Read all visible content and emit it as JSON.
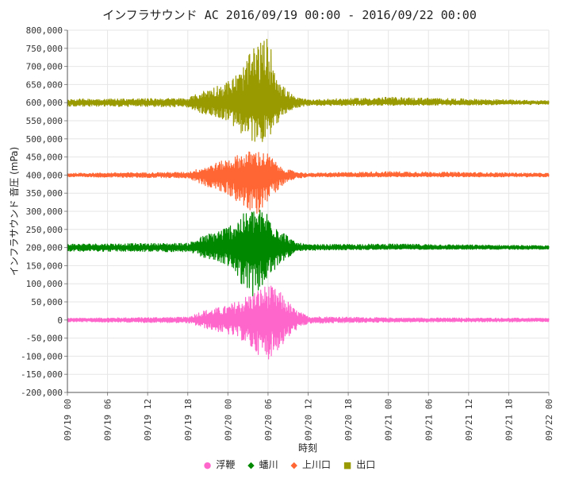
{
  "chart_data": {
    "type": "line",
    "title": "インフラサウンド AC 2016/09/19 00:00 - 2016/09/22 00:00",
    "xlabel": "時刻",
    "ylabel": "インフラサウンド 音圧 (mPa)",
    "ylim": [
      -200000,
      800000
    ],
    "yticks": [
      "800,000",
      "750,000",
      "700,000",
      "650,000",
      "600,000",
      "550,000",
      "500,000",
      "450,000",
      "400,000",
      "350,000",
      "300,000",
      "250,000",
      "200,000",
      "150,000",
      "100,000",
      "50,000",
      "0",
      "-50,000",
      "-100,000",
      "-150,000",
      "-200,000"
    ],
    "xlim_hours": [
      0,
      72
    ],
    "xticks": [
      "09/19 00",
      "09/19 06",
      "09/19 12",
      "09/19 18",
      "09/20 00",
      "09/20 06",
      "09/20 12",
      "09/20 18",
      "09/21 00",
      "09/21 06",
      "09/21 12",
      "09/21 18",
      "09/22 00"
    ],
    "grid": true,
    "legend_position": "bottom",
    "series": [
      {
        "name": "浮鞭",
        "color": "#ff66cc",
        "marker": "dot",
        "baseline": 0,
        "envelope": [
          [
            0,
            -5000,
            5000
          ],
          [
            18,
            -8000,
            8000
          ],
          [
            20,
            -20000,
            25000
          ],
          [
            24,
            -40000,
            40000
          ],
          [
            26,
            -55000,
            60000
          ],
          [
            28,
            -90000,
            80000
          ],
          [
            30,
            -110000,
            100000
          ],
          [
            32,
            -75000,
            75000
          ],
          [
            34,
            -30000,
            30000
          ],
          [
            36,
            -10000,
            10000
          ],
          [
            48,
            -6000,
            6000
          ],
          [
            72,
            -5000,
            5000
          ]
        ]
      },
      {
        "name": "蟠川",
        "color": "#008800",
        "marker": "diamond",
        "baseline": 200000,
        "envelope": [
          [
            0,
            190000,
            210000
          ],
          [
            18,
            188000,
            212000
          ],
          [
            20,
            175000,
            230000
          ],
          [
            24,
            150000,
            260000
          ],
          [
            26,
            100000,
            290000
          ],
          [
            28,
            60000,
            310000
          ],
          [
            30,
            110000,
            300000
          ],
          [
            32,
            160000,
            250000
          ],
          [
            34,
            185000,
            215000
          ],
          [
            36,
            192000,
            208000
          ],
          [
            48,
            195000,
            210000
          ],
          [
            72,
            195000,
            205000
          ]
        ]
      },
      {
        "name": "上川口",
        "color": "#ff6633",
        "marker": "diamond",
        "baseline": 400000,
        "envelope": [
          [
            0,
            395000,
            405000
          ],
          [
            18,
            392000,
            408000
          ],
          [
            20,
            375000,
            420000
          ],
          [
            24,
            345000,
            445000
          ],
          [
            26,
            320000,
            460000
          ],
          [
            28,
            280000,
            470000
          ],
          [
            30,
            330000,
            460000
          ],
          [
            32,
            370000,
            420000
          ],
          [
            34,
            390000,
            410000
          ],
          [
            36,
            395000,
            405000
          ],
          [
            48,
            395000,
            410000
          ],
          [
            72,
            395000,
            405000
          ]
        ]
      },
      {
        "name": "出口",
        "color": "#999900",
        "marker": "square",
        "baseline": 600000,
        "envelope": [
          [
            0,
            590000,
            610000
          ],
          [
            18,
            588000,
            612000
          ],
          [
            20,
            570000,
            630000
          ],
          [
            24,
            550000,
            660000
          ],
          [
            26,
            510000,
            690000
          ],
          [
            28,
            480000,
            760000
          ],
          [
            30,
            500000,
            780000
          ],
          [
            32,
            560000,
            650000
          ],
          [
            34,
            585000,
            615000
          ],
          [
            36,
            592000,
            608000
          ],
          [
            48,
            592000,
            615000
          ],
          [
            72,
            595000,
            605000
          ]
        ]
      }
    ]
  }
}
